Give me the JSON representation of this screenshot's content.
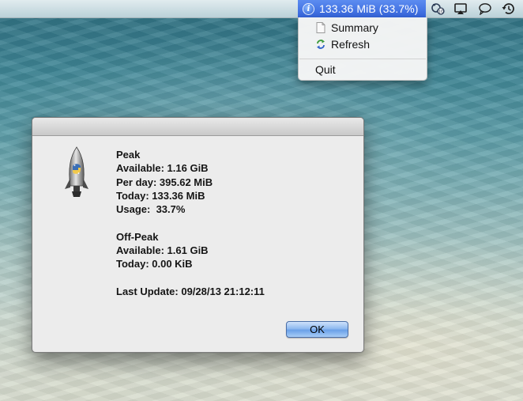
{
  "menubar": {
    "status_text": "133.36 MiB (33.7%)",
    "status_icon": "info-icon",
    "extra_icons": [
      "sync-status-icon",
      "airplay-icon",
      "chat-bubble-icon",
      "time-machine-icon"
    ]
  },
  "menu": {
    "items": [
      {
        "label": "Summary",
        "icon": "document-icon"
      },
      {
        "label": "Refresh",
        "icon": "refresh-icon"
      },
      {
        "label": "Quit"
      }
    ]
  },
  "alert": {
    "app_icon": "python-rocket-icon",
    "peak": {
      "heading": "Peak",
      "available": "Available: 1.16 GiB",
      "per_day": "Per day: 395.62 MiB",
      "today": "Today: 133.36 MiB",
      "usage": "Usage:  33.7%"
    },
    "offpeak": {
      "heading": "Off-Peak",
      "available": "Available: 1.61 GiB",
      "today": "Today: 0.00 KiB"
    },
    "last_update": "Last Update: 09/28/13 21:12:11",
    "ok_label": "OK"
  },
  "colors": {
    "menu_highlight": "#3d6fe0",
    "button_blue": "#8fbaf0"
  }
}
